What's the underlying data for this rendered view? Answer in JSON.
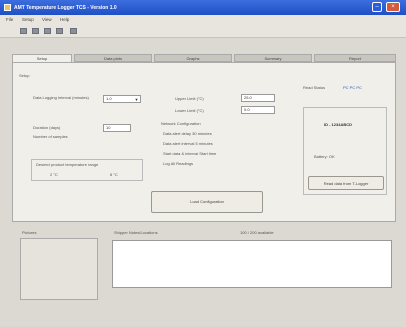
{
  "window": {
    "title": "AMT Temperature Logger TCS - Version 1.0"
  },
  "menu": [
    "File",
    "Setup",
    "View",
    "Help"
  ],
  "toolbar": {
    "icons": [
      "new-icon",
      "open-icon",
      "save-icon",
      "print-icon",
      "help-icon"
    ]
  },
  "tabs": [
    "Setup",
    "Data plots",
    "Graphs",
    "Summary",
    "Report"
  ],
  "setup": {
    "group_label": "Setup",
    "logging_interval_label": "Data Logging Interval (minutes)",
    "logging_interval_value": "1.0",
    "duration_label": "Duration (days)",
    "duration_value": "10",
    "samples_label": "Number of samples",
    "range_label": "Desired product temperature range",
    "range_low": "2 °C",
    "range_high": "8 °C",
    "upper_limit_label": "Upper Limit (°C)",
    "upper_limit_value": "25.0",
    "lower_limit_label": "Lower Limit (°C)",
    "lower_limit_value": "0.0",
    "config_header": "Network Configuration",
    "config_lines": [
      "Data alert delay   30 minutes",
      "Data alert interval   5 minutes",
      "Start data & interval   Start time",
      "Log All Readings"
    ]
  },
  "status": {
    "label": "Read Status",
    "value": "PC  PC  PC",
    "id_value": "ID - 1234ABCD",
    "battery_label": "Battery:  OK",
    "read_button": "Read data from T-Logger"
  },
  "load_button": "Load Configuration",
  "pictures": {
    "label": "Pictures"
  },
  "notes": {
    "label": "Shipper Notes/Locations",
    "counter": "100 / 200 available"
  }
}
